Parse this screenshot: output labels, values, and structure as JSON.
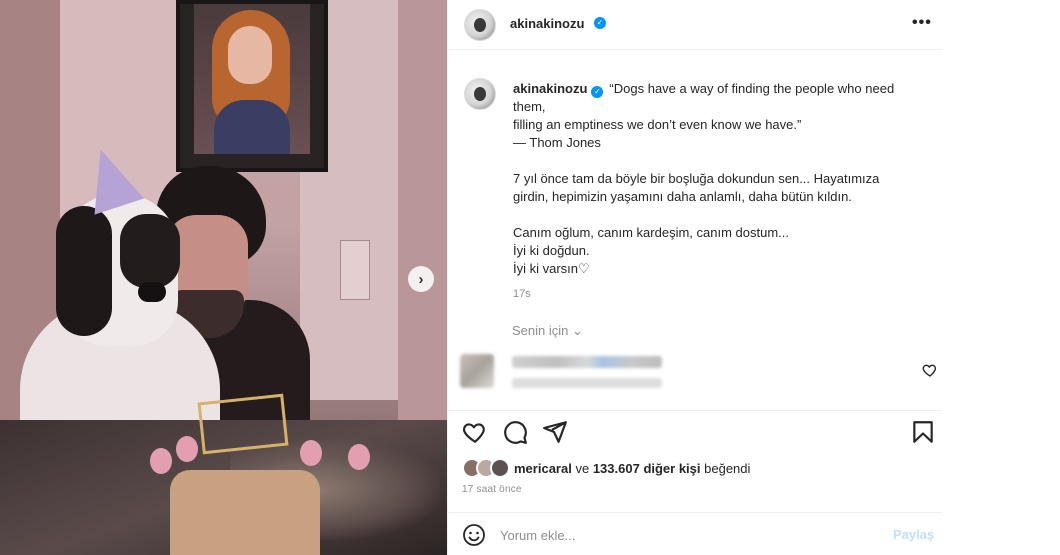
{
  "header": {
    "username": "akinakinozu",
    "more_label": "•••"
  },
  "caption": {
    "username": "akinakinozu",
    "lines": [
      "“Dogs have a way of finding the people who need",
      "them,",
      "filling an emptiness we don’t even know we have.”",
      "— Thom Jones",
      "",
      "7 yıl önce tam da böyle bir boşluğa dokundun sen... Hayatımıza",
      "girdin, hepimizin yaşamını daha anlamlı, daha bütün kıldın.",
      "",
      "Canım oğlum, canım kardeşim, canım dostum...",
      "İyi ki doğdun.",
      "İyi ki varsın♡"
    ],
    "age": "17s"
  },
  "for_you": {
    "label": "Senin için",
    "chevron": "⌄"
  },
  "carousel": {
    "next_label": "›"
  },
  "likes": {
    "first_user": "mericaral",
    "connector": "ve",
    "count": "133.607",
    "others_label": "diğer kişi",
    "suffix": "beğendi"
  },
  "time": "17 saat önce",
  "comment_box": {
    "placeholder": "Yorum ekle...",
    "post_label": "Paylaş"
  },
  "icons": {
    "like": "heart-icon",
    "comment": "comment-bubble-icon",
    "share": "paper-plane-icon",
    "save": "bookmark-icon",
    "emoji": "smiley-icon",
    "verified": "verified-badge-icon"
  },
  "colors": {
    "verified": "#0095f6",
    "muted_text": "#8e8e8e",
    "post_button_disabled": "#c0dffd"
  }
}
